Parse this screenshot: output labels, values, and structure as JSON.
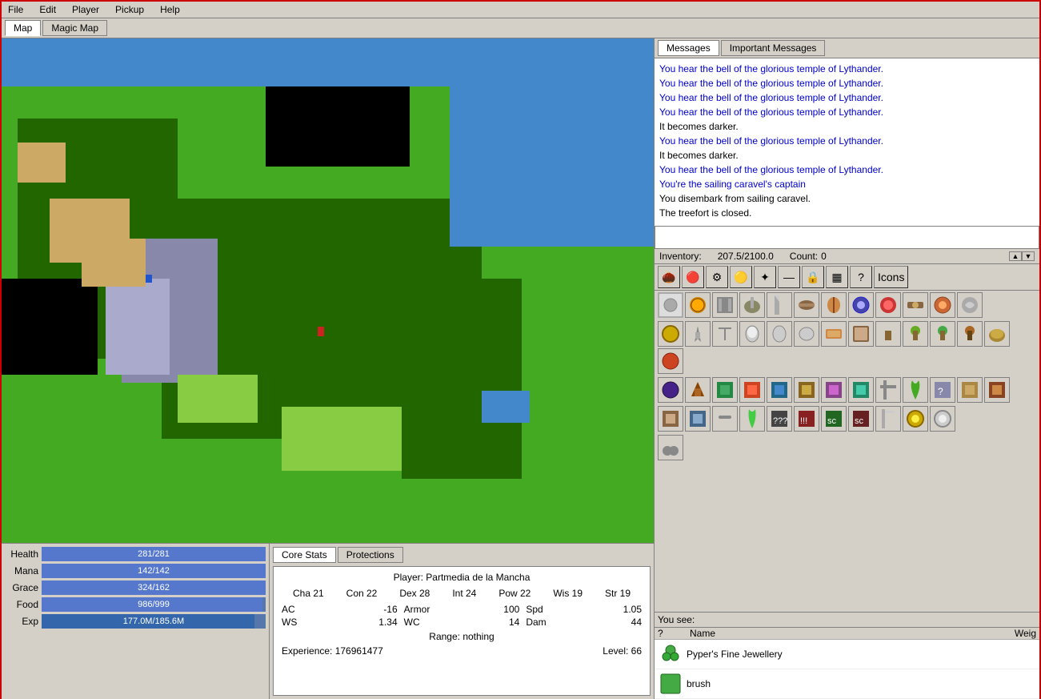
{
  "app": {
    "title": "Crossfire Client"
  },
  "menubar": {
    "items": [
      "File",
      "Edit",
      "Player",
      "Pickup",
      "Help"
    ]
  },
  "map_tabs": [
    {
      "label": "Map",
      "active": true
    },
    {
      "label": "Magic Map",
      "active": false
    }
  ],
  "messages": {
    "tabs": [
      {
        "label": "Messages",
        "active": true
      },
      {
        "label": "Important Messages",
        "active": false
      }
    ],
    "lines": [
      {
        "text": "You hear the bell of the glorious temple of Lythander.",
        "type": "blue"
      },
      {
        "text": "You hear the bell of the glorious temple of Lythander.",
        "type": "blue"
      },
      {
        "text": "You hear the bell of the glorious temple of Lythander.",
        "type": "blue"
      },
      {
        "text": "You hear the bell of the glorious temple of Lythander.",
        "type": "blue"
      },
      {
        "text": "It becomes darker.",
        "type": "black"
      },
      {
        "text": "You hear the bell of the glorious temple of Lythander.",
        "type": "blue"
      },
      {
        "text": "It becomes darker.",
        "type": "black"
      },
      {
        "text": "You hear the bell of the glorious temple of Lythander.",
        "type": "blue"
      },
      {
        "text": "You're the sailing caravel's captain",
        "type": "blue"
      },
      {
        "text": "You disembark from sailing caravel.",
        "type": "black"
      },
      {
        "text": "The treefort is closed.",
        "type": "black"
      }
    ]
  },
  "inventory": {
    "title": "Inventory:",
    "weight": "207.5/2100.0",
    "count_label": "Count:",
    "count_value": "0",
    "toolbar_icons": [
      "🌰",
      "🦟",
      "⚙️",
      "🟡",
      "⚜️",
      "➖",
      "🔒",
      "🔲",
      "❓",
      "Icons"
    ],
    "icons_label": "Icons"
  },
  "stats": {
    "health_label": "Health",
    "health_value": "281/281",
    "health_pct": 100,
    "mana_label": "Mana",
    "mana_value": "142/142",
    "mana_pct": 100,
    "grace_label": "Grace",
    "grace_value": "324/162",
    "grace_pct": 100,
    "food_label": "Food",
    "food_value": "986/999",
    "food_pct": 98.7,
    "exp_label": "Exp",
    "exp_value": "177.0M/185.6M",
    "exp_pct": 95
  },
  "char_tabs": [
    {
      "label": "Core Stats",
      "active": true
    },
    {
      "label": "Protections",
      "active": false
    }
  ],
  "char_stats": {
    "player_name": "Player: Partmedia de la Mancha",
    "attributes": [
      {
        "label": "Cha",
        "value": "21"
      },
      {
        "label": "Con",
        "value": "22"
      },
      {
        "label": "Dex",
        "value": "28"
      },
      {
        "label": "Int",
        "value": "24"
      },
      {
        "label": "Pow",
        "value": "22"
      },
      {
        "label": "Wis",
        "value": "19"
      },
      {
        "label": "Str",
        "value": "19"
      }
    ],
    "combat": [
      {
        "label": "AC",
        "value": "-16"
      },
      {
        "label": "Armor",
        "value": "100"
      },
      {
        "label": "Spd",
        "value": "1.05"
      },
      {
        "label": "WS",
        "value": "1.34"
      },
      {
        "label": "WC",
        "value": "14"
      },
      {
        "label": "Dam",
        "value": "44"
      }
    ],
    "range": "Range: nothing",
    "experience": "Experience: 176961477",
    "level": "Level: 66"
  },
  "you_see": {
    "title": "You see:",
    "columns": {
      "q": "?",
      "name": "Name",
      "weight": "Weig"
    },
    "items": [
      {
        "icon": "💎",
        "name": "Pyper's Fine Jewellery",
        "icon_color": "green"
      },
      {
        "icon": "🟩",
        "name": "brush",
        "icon_color": "green"
      }
    ]
  }
}
